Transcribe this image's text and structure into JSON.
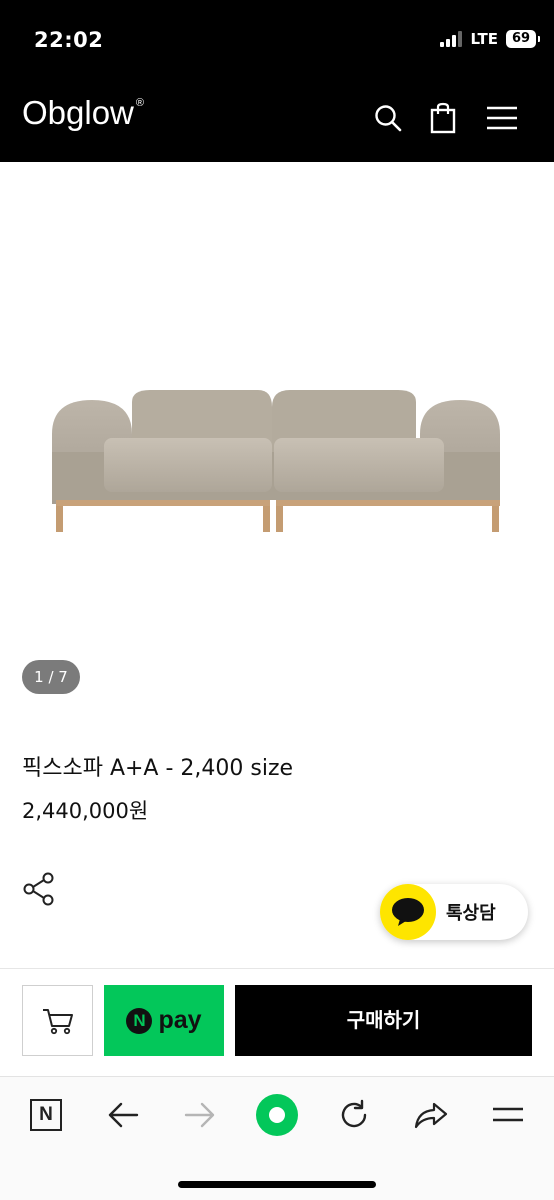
{
  "status_bar": {
    "time": "22:02",
    "network": "LTE",
    "battery": "69"
  },
  "header": {
    "logo": "Obglow",
    "logo_mark": "®",
    "icons": [
      "search-icon",
      "shopping-bag-icon",
      "hamburger-menu-icon"
    ]
  },
  "gallery": {
    "counter": "1 / 7"
  },
  "product": {
    "name": "픽스소파 A+A - 2,400 size",
    "price": "2,440,000원"
  },
  "chat": {
    "label": "톡상담"
  },
  "actions": {
    "npay_brand": "N",
    "npay_label": "pay",
    "buy_label": "구매하기"
  },
  "browser_bar": {
    "n_label": "N",
    "icons": [
      "naver-n-icon",
      "back-arrow-icon",
      "forward-arrow-icon",
      "green-dot-icon",
      "refresh-icon",
      "share-arrow-icon",
      "menu-lines-icon"
    ]
  },
  "colors": {
    "header_bg": "#000000",
    "npay_green": "#03c75a",
    "kakao_yellow": "#fee500",
    "buy_bg": "#000000"
  }
}
